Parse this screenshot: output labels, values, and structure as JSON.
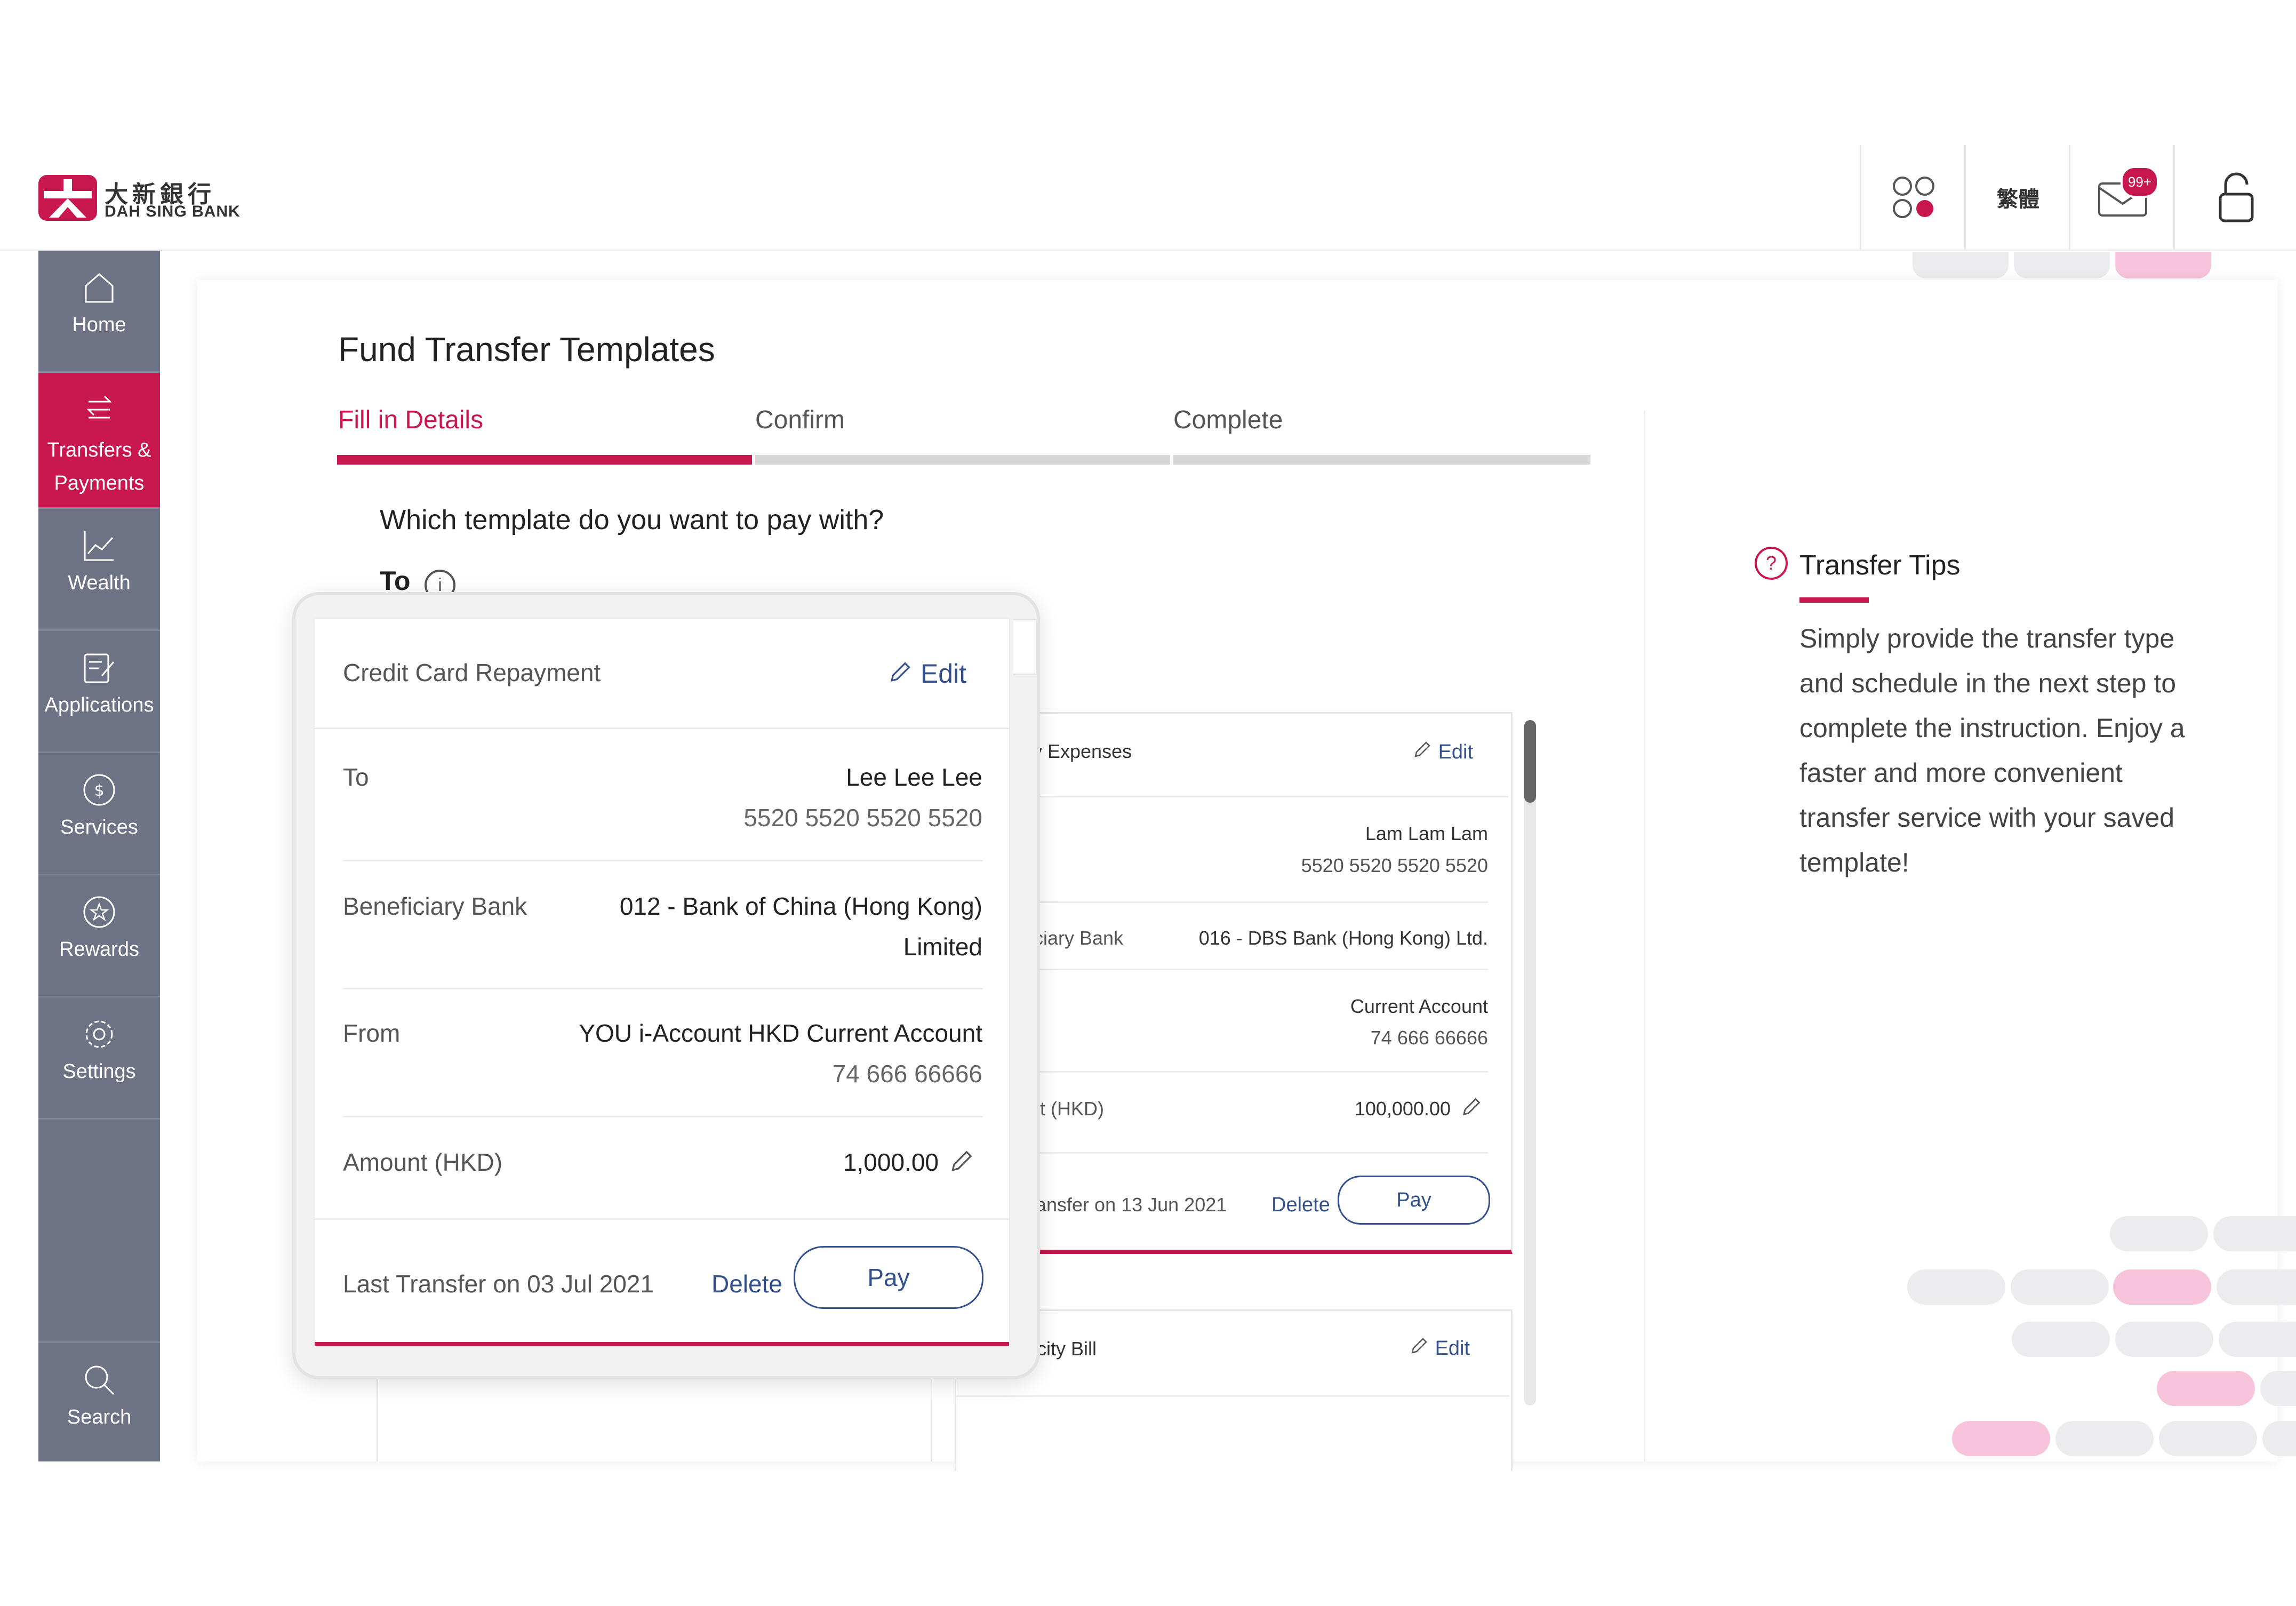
{
  "header": {
    "logo_cn": "大新銀行",
    "logo_en": "DAH SING BANK",
    "lang_toggle": "繁體",
    "mail_badge": "99+"
  },
  "sidebar": {
    "items": [
      {
        "label": "Home",
        "icon": "home-icon"
      },
      {
        "label": "Transfers & Payments",
        "icon": "transfer-icon",
        "active": true
      },
      {
        "label": "Wealth",
        "icon": "chart-icon"
      },
      {
        "label": "Applications",
        "icon": "application-icon"
      },
      {
        "label": "Services",
        "icon": "dollar-icon"
      },
      {
        "label": "Rewards",
        "icon": "star-icon"
      },
      {
        "label": "Settings",
        "icon": "gear-icon"
      },
      {
        "label": "Search",
        "icon": "search-icon"
      }
    ]
  },
  "page": {
    "title": "Fund Transfer Templates",
    "steps": [
      "Fill in Details",
      "Confirm",
      "Complete"
    ],
    "question": "Which template do you want to pay with?",
    "to_label": "To",
    "info": "i"
  },
  "popup": {
    "name": "Credit Card Repayment",
    "edit": "Edit",
    "to_label": "To",
    "to_name": "Lee Lee Lee",
    "to_number": "5520 5520 5520 5520",
    "bank_label": "Beneficiary Bank",
    "bank_line1": "012 - Bank of China (Hong Kong)",
    "bank_line2": "Limited",
    "from_label": "From",
    "from_account": "YOU i-Account HKD Current Account",
    "from_number": "74 666 66666",
    "amount_label": "Amount (HKD)",
    "amount": "1,000.00",
    "last_transfer": "Last Transfer on 03 Jul 2021",
    "delete": "Delete",
    "pay": "Pay"
  },
  "bg_card1": {
    "name_partial": "y Expenses",
    "edit": "Edit",
    "to_name": "Lam Lam Lam",
    "to_number": "5520 5520 5520 5520",
    "bank_label_partial": "iciary Bank",
    "bank": "016 - DBS Bank (Hong Kong) Ltd.",
    "from_account": "Current Account",
    "from_number": "74 666 66666",
    "amount_label_partial": "nt (HKD)",
    "amount": "100,000.00",
    "last_transfer_partial": "ransfer on 13 Jun 2021",
    "delete": "Delete",
    "pay": "Pay"
  },
  "bg_card2": {
    "name_partial": "icity Bill",
    "edit": "Edit"
  },
  "tips": {
    "icon": "?",
    "title": "Transfer Tips",
    "body": "Simply provide the transfer type and schedule in the next step to complete the instruction. Enjoy a faster and more convenient transfer service with your saved template!"
  },
  "colors": {
    "brand": "#c8174f",
    "sidebar": "#6d7384",
    "link": "#33508d",
    "pill_pink": "#f7c4dc",
    "pill_gray": "#ececee"
  }
}
